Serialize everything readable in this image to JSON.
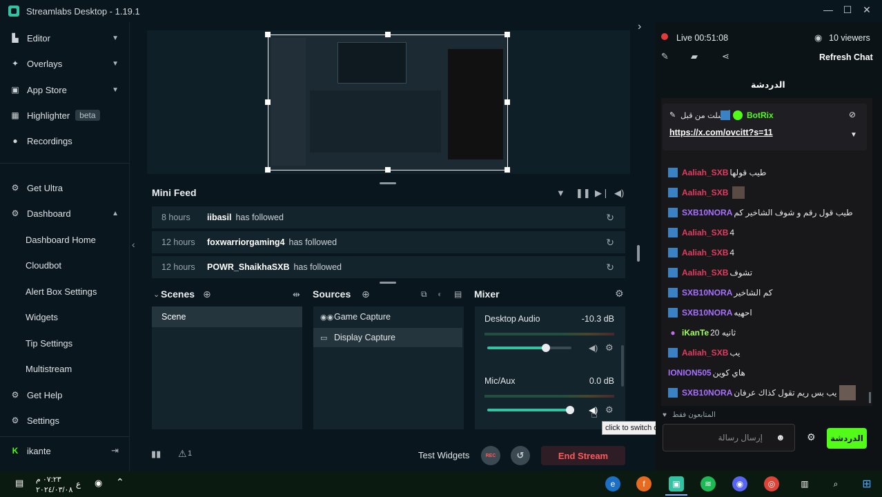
{
  "window": {
    "title": "Streamlabs Desktop - 1.19.1",
    "minimize": "—",
    "maximize": "☐",
    "close": "✕"
  },
  "sidebar": {
    "items": [
      {
        "label": "Editor",
        "icon": "editor-icon"
      },
      {
        "label": "Overlays",
        "icon": "overlays-icon"
      },
      {
        "label": "App Store",
        "icon": "app-store-icon"
      },
      {
        "label": "Highlighter",
        "icon": "highlighter-icon",
        "badge": "beta"
      },
      {
        "label": "Recordings",
        "icon": "recordings-icon"
      },
      {
        "label": "Get Ultra",
        "icon": "ultra-icon"
      },
      {
        "label": "Dashboard",
        "icon": "dashboard-icon"
      }
    ],
    "dashboard_sub": [
      "Dashboard Home",
      "Cloudbot",
      "Alert Box Settings",
      "Widgets",
      "Tip Settings",
      "Multistream"
    ],
    "get_help": "Get Help",
    "settings": "Settings",
    "user": "ikante"
  },
  "minifeed": {
    "title": "Mini Feed",
    "rows": [
      {
        "time": "8 hours",
        "name": "iibasil",
        "action": "has followed"
      },
      {
        "time": "12 hours",
        "name": "foxwarriorgaming4",
        "action": "has followed"
      },
      {
        "time": "12 hours",
        "name": "POWR_ShaikhaSXB",
        "action": "has followed"
      }
    ]
  },
  "scenes": {
    "title": "Scenes",
    "items": [
      "Scene"
    ]
  },
  "sources": {
    "title": "Sources",
    "items": [
      {
        "label": "Game Capture",
        "icon": "gamepad-icon"
      },
      {
        "label": "Display Capture",
        "icon": "monitor-icon"
      }
    ]
  },
  "mixer": {
    "title": "Mixer",
    "channels": [
      {
        "name": "Desktop Audio",
        "db": "-10.3 dB",
        "level": 0.7
      },
      {
        "name": "Mic/Aux",
        "db": "0.0 dB",
        "level": 0.98
      }
    ],
    "tooltip": "click to switch off"
  },
  "bottombar": {
    "test_widgets": "Test Widgets",
    "rec": "REC",
    "end_stream": "End Stream",
    "alerts_count": "1"
  },
  "chat": {
    "live_status": "Live 00:51:08",
    "viewers": "10 viewers",
    "refresh": "Refresh Chat",
    "tab": "الدردشة",
    "pinned": {
      "sent_by": "أرسلت من قبل",
      "user": "BotRix",
      "link": "https://x.com/ovcitt?s=11"
    },
    "messages": [
      {
        "user": "Aaliah_SXB",
        "color": "#e23b5f",
        "text": "طيب قولها"
      },
      {
        "user": "Aaliah_SXB",
        "color": "#e23b5f",
        "text": ""
      },
      {
        "user": "SXB10NORA",
        "color": "#a970ff",
        "text": "طيب قول رقم و شوف الشاخير كم"
      },
      {
        "user": "Aaliah_SXB",
        "color": "#e23b5f",
        "text": "4"
      },
      {
        "user": "Aaliah_SXB",
        "color": "#e23b5f",
        "text": "4"
      },
      {
        "user": "Aaliah_SXB",
        "color": "#e23b5f",
        "text": "تشوف"
      },
      {
        "user": "SXB10NORA",
        "color": "#a970ff",
        "text": "كم الشاخير"
      },
      {
        "user": "SXB10NORA",
        "color": "#a970ff",
        "text": "احهيه"
      },
      {
        "user": "iKanTe",
        "color": "#a3ff5a",
        "text": "20 ثانيه"
      },
      {
        "user": "Aaliah_SXB",
        "color": "#e23b5f",
        "text": "يب"
      },
      {
        "user": "IONION505",
        "color": "#a970ff",
        "text": "هاي كوين"
      },
      {
        "user": "SXB10NORA",
        "color": "#a970ff",
        "text": "يب بس ريم تقول كذاك عرفان"
      }
    ],
    "followers_only": "المتابعون فقط",
    "input_placeholder": "إرسال رسالة",
    "send": "الدردشة"
  },
  "taskbar": {
    "time": "٠٧:٢٣ م",
    "date": "٢٠٢٤/٠٣/٠٨",
    "lang": "ع"
  },
  "colors": {
    "accent": "#31c3a2",
    "end_stream": "#ff5a5a",
    "chat_send": "#53fc18"
  }
}
